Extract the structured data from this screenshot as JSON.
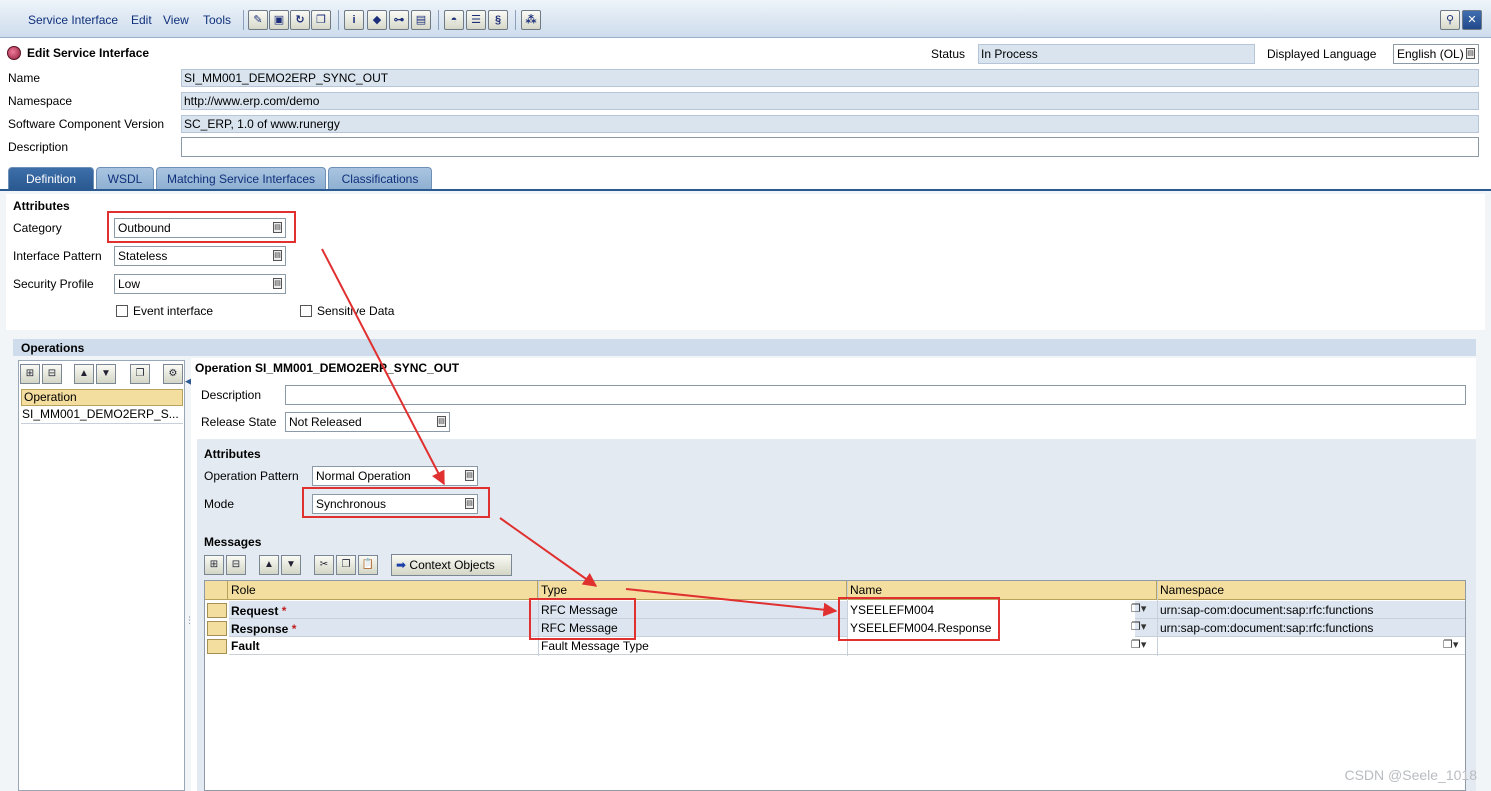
{
  "menu": [
    "Service Interface",
    "Edit",
    "View",
    "Tools"
  ],
  "header": {
    "title": "Edit Service Interface",
    "status_label": "Status",
    "status_value": "In Process",
    "lang_label": "Displayed Language",
    "lang_value": "English (OL)",
    "name_label": "Name",
    "name_value": "SI_MM001_DEMO2ERP_SYNC_OUT",
    "namespace_label": "Namespace",
    "namespace_value": "http://www.erp.com/demo",
    "scv_label": "Software Component Version",
    "scv_value": "SC_ERP, 1.0 of www.runergy",
    "description_label": "Description",
    "description_value": ""
  },
  "tabs": [
    "Definition",
    "WSDL",
    "Matching Service Interfaces",
    "Classifications"
  ],
  "attributes": {
    "title": "Attributes",
    "category_label": "Category",
    "category_value": "Outbound",
    "pattern_label": "Interface Pattern",
    "pattern_value": "Stateless",
    "security_label": "Security Profile",
    "security_value": "Low",
    "event_label": "Event interface",
    "sensitive_label": "Sensitive Data"
  },
  "operations": {
    "title": "Operations",
    "column": "Operation",
    "item": "SI_MM001_DEMO2ERP_S...",
    "detail_title": "Operation SI_MM001_DEMO2ERP_SYNC_OUT",
    "description_label": "Description",
    "release_label": "Release State",
    "release_value": "Not Released",
    "attr_title": "Attributes",
    "op_pattern_label": "Operation Pattern",
    "op_pattern_value": "Normal Operation",
    "mode_label": "Mode",
    "mode_value": "Synchronous"
  },
  "messages": {
    "title": "Messages",
    "context_button": "Context Objects",
    "columns": [
      "Role",
      "Type",
      "Name",
      "Namespace"
    ],
    "rows": [
      {
        "role": "Request",
        "required": "*",
        "type": "RFC Message",
        "name": "YSEELEFM004",
        "namespace": "urn:sap-com:document:sap:rfc:functions"
      },
      {
        "role": "Response",
        "required": "*",
        "type": "RFC Message",
        "name": "YSEELEFM004.Response",
        "namespace": "urn:sap-com:document:sap:rfc:functions"
      },
      {
        "role": "Fault",
        "required": "",
        "type": "Fault Message Type",
        "name": "",
        "namespace": ""
      }
    ]
  },
  "watermark": "CSDN @Seele_1018",
  "colors": {
    "highlight": "#e03030",
    "tab_active": "#2b5992",
    "table_header": "#f3dd9f"
  }
}
